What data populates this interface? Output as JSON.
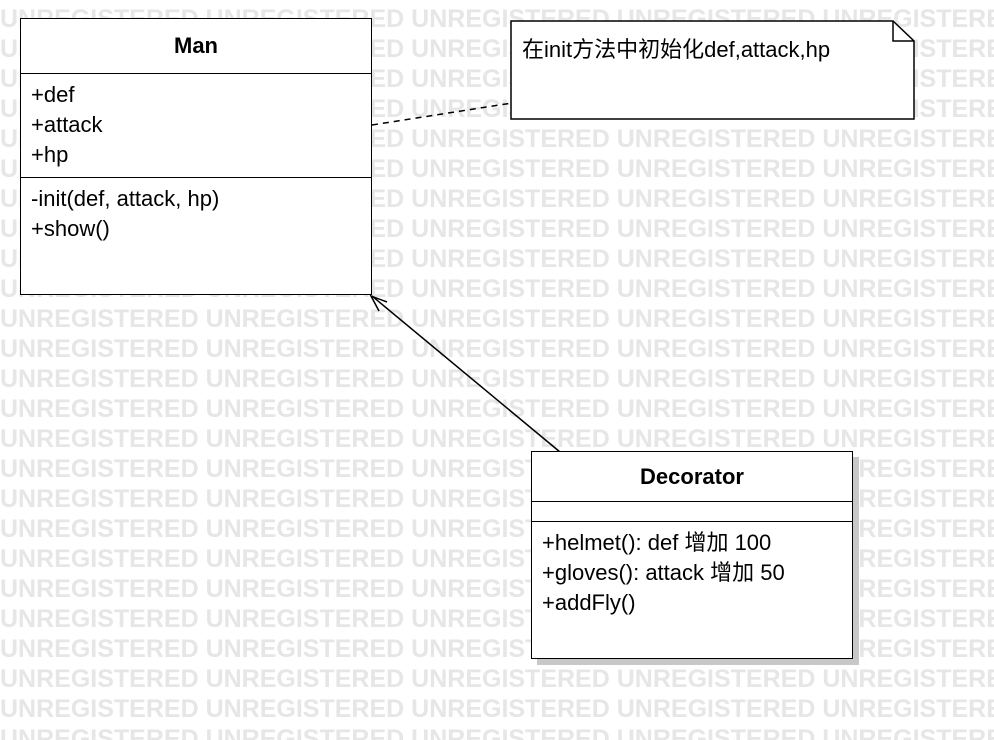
{
  "watermark_text": "UNREGISTERED",
  "classes": {
    "man": {
      "name": "Man",
      "attributes": [
        "+def",
        "+attack",
        "+hp"
      ],
      "operations": [
        "-init(def, attack, hp)",
        "+show()"
      ]
    },
    "decorator": {
      "name": "Decorator",
      "attributes": [],
      "operations": [
        "+helmet(): def 增加 100",
        "+gloves(): attack 增加 50",
        "+addFly()"
      ]
    }
  },
  "note": {
    "text": "在init方法中初始化def,attack,hp"
  }
}
